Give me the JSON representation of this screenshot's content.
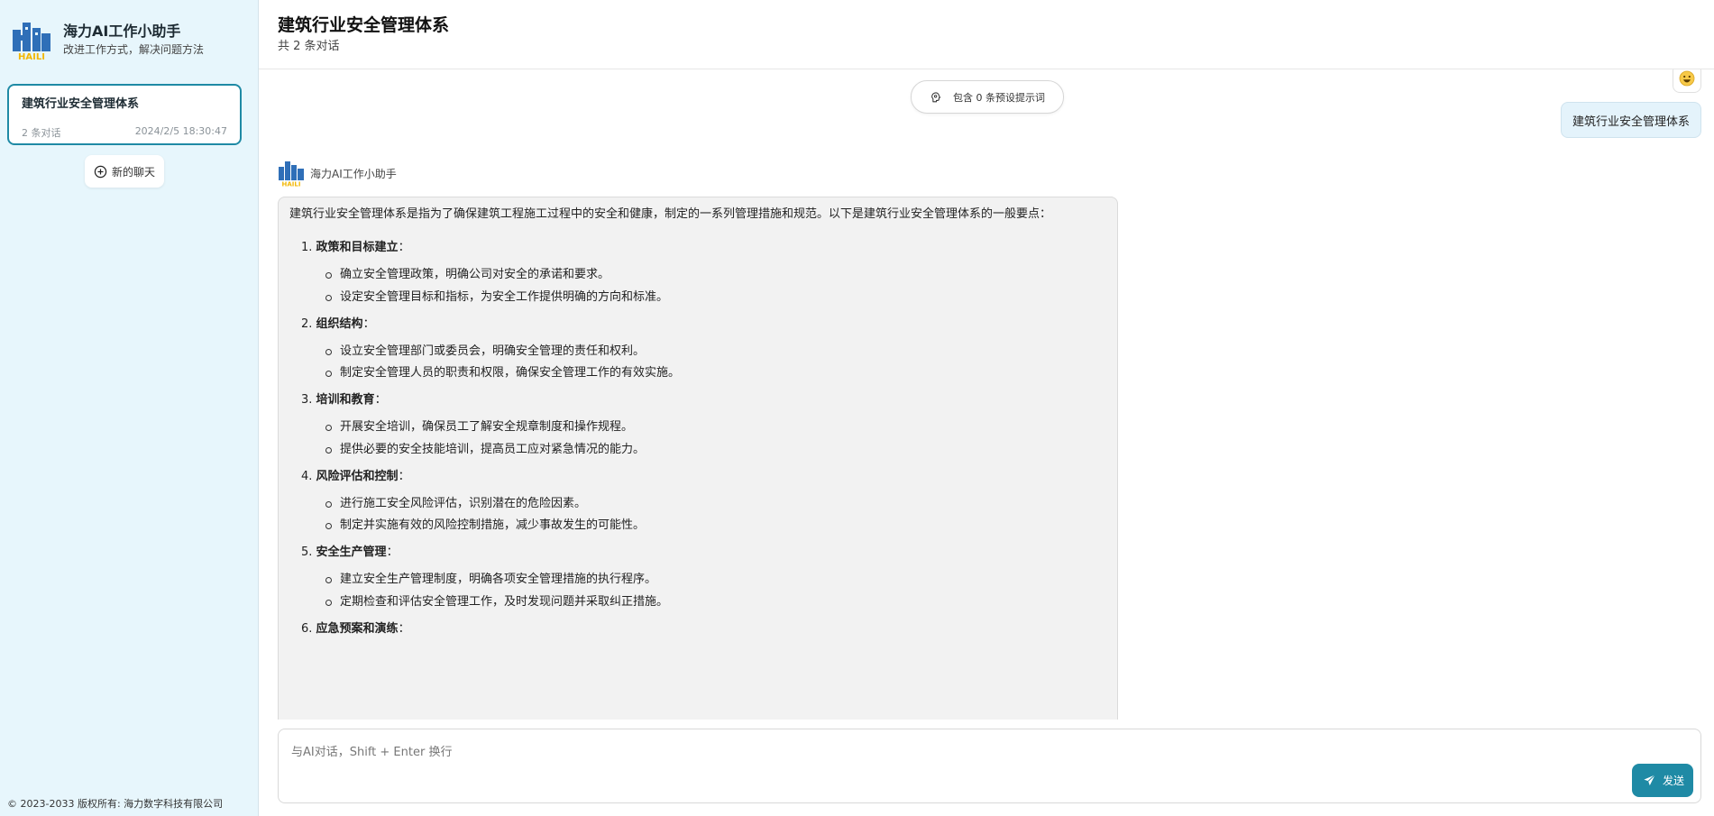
{
  "app": {
    "title": "海力AI工作小助手",
    "subtitle": "改进工作方式，解决问题方法",
    "logo_text": "HAILI",
    "logo_icon": "haili-building-logo"
  },
  "sidebar": {
    "session": {
      "title": "建筑行业安全管理体系",
      "count": "2 条对话",
      "time": "2024/2/5 18:30:47"
    },
    "new_chat_label": "新的聊天",
    "new_chat_icon": "plus-circle-icon",
    "footer": "© 2023-2033 版权所有: 海力数字科技有限公司"
  },
  "header": {
    "title": "建筑行业安全管理体系",
    "subtitle": "共 2 条对话"
  },
  "chat": {
    "prompt_pill": "包含 0 条预设提示词",
    "prompt_icon": "brain-icon",
    "user_avatar_icon": "smiley-emoji-icon",
    "user_message": "建筑行业安全管理体系",
    "ai_name": "海力AI工作小助手",
    "ai_intro": "建筑行业安全管理体系是指为了确保建筑工程施工过程中的安全和健康，制定的一系列管理措施和规范。以下是建筑行业安全管理体系的一般要点：",
    "points": [
      {
        "num": "1.",
        "title": "政策和目标建立",
        "items": [
          "确立安全管理政策，明确公司对安全的承诺和要求。",
          "设定安全管理目标和指标，为安全工作提供明确的方向和标准。"
        ]
      },
      {
        "num": "2.",
        "title": "组织结构",
        "items": [
          "设立安全管理部门或委员会，明确安全管理的责任和权利。",
          "制定安全管理人员的职责和权限，确保安全管理工作的有效实施。"
        ]
      },
      {
        "num": "3.",
        "title": "培训和教育",
        "items": [
          "开展安全培训，确保员工了解安全规章制度和操作规程。",
          "提供必要的安全技能培训，提高员工应对紧急情况的能力。"
        ]
      },
      {
        "num": "4.",
        "title": "风险评估和控制",
        "items": [
          "进行施工安全风险评估，识别潜在的危险因素。",
          "制定并实施有效的风险控制措施，减少事故发生的可能性。"
        ]
      },
      {
        "num": "5.",
        "title": "安全生产管理",
        "items": [
          "建立安全生产管理制度，明确各项安全管理措施的执行程序。",
          "定期检查和评估安全管理工作，及时发现问题并采取纠正措施。"
        ]
      },
      {
        "num": "6.",
        "title": "应急预案和演练",
        "items": []
      }
    ]
  },
  "input": {
    "placeholder": "与AI对话，Shift + Enter 换行",
    "value": "",
    "send_label": "发送",
    "send_icon": "paper-plane-icon"
  },
  "colors": {
    "sidebar_bg": "#e7f6fc",
    "accent": "#1f8aa5",
    "user_bubble": "#e4f3fb",
    "ai_bubble": "#f2f2f2",
    "logo_blue": "#2f6fb8",
    "logo_yellow": "#f2b705"
  }
}
